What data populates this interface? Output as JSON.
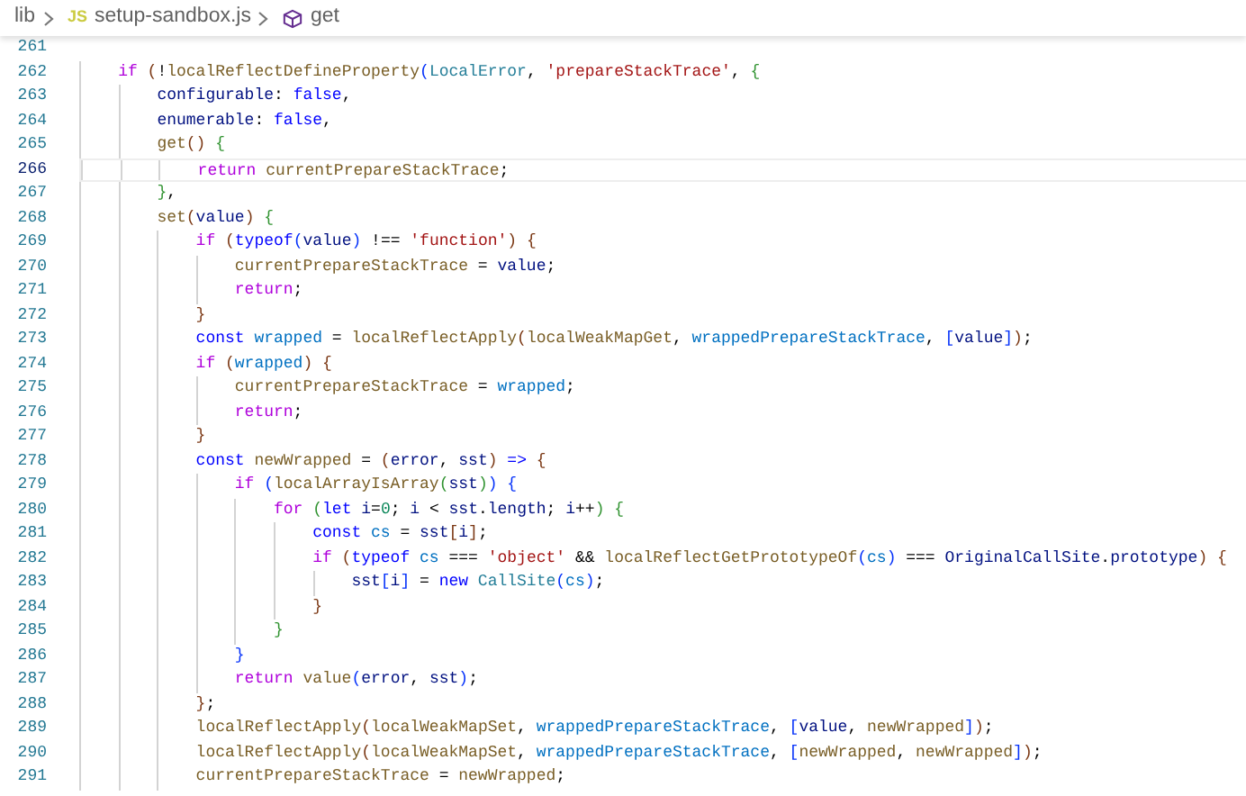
{
  "breadcrumb": {
    "folder": "lib",
    "file_icon_label": "JS",
    "file": "setup-sandbox.js",
    "symbol": "get"
  },
  "lines": [
    {
      "number": "261",
      "current": false
    },
    {
      "number": "262",
      "current": false,
      "tokens": [
        {
          "text": "    if ",
          "kind": "ctrl"
        },
        {
          "text": "(",
          "kind": "b3"
        },
        {
          "text": "!",
          "kind": "plain"
        },
        {
          "text": "localReflectDefineProperty",
          "kind": "fn"
        },
        {
          "text": "(",
          "kind": "b1"
        },
        {
          "text": "LocalError",
          "kind": "type"
        },
        {
          "text": ", ",
          "kind": "plain"
        },
        {
          "text": "'prepareStackTrace'",
          "kind": "str"
        },
        {
          "text": ", ",
          "kind": "plain"
        },
        {
          "text": "{",
          "kind": "b2"
        }
      ]
    },
    {
      "number": "263",
      "current": false,
      "tokens": [
        {
          "text": "        configurable",
          "kind": "var"
        },
        {
          "text": ": ",
          "kind": "plain"
        },
        {
          "text": "false",
          "kind": "kw"
        },
        {
          "text": ",",
          "kind": "plain"
        }
      ]
    },
    {
      "number": "264",
      "current": false,
      "tokens": [
        {
          "text": "        enumerable",
          "kind": "var"
        },
        {
          "text": ": ",
          "kind": "plain"
        },
        {
          "text": "false",
          "kind": "kw"
        },
        {
          "text": ",",
          "kind": "plain"
        }
      ]
    },
    {
      "number": "265",
      "current": false,
      "tokens": [
        {
          "text": "        get",
          "kind": "fn"
        },
        {
          "text": "() ",
          "kind": "b3"
        },
        {
          "text": "{",
          "kind": "b2"
        }
      ]
    },
    {
      "number": "266",
      "current": true,
      "tokens": [
        {
          "text": "            return ",
          "kind": "ctrl"
        },
        {
          "text": "currentPrepareStackTrace",
          "kind": "fn"
        },
        {
          "text": ";",
          "kind": "plain"
        }
      ]
    },
    {
      "number": "267",
      "current": false,
      "tokens": [
        {
          "text": "        }",
          "kind": "b2"
        },
        {
          "text": ",",
          "kind": "plain"
        }
      ]
    },
    {
      "number": "268",
      "current": false,
      "tokens": [
        {
          "text": "        set",
          "kind": "fn"
        },
        {
          "text": "(",
          "kind": "b3"
        },
        {
          "text": "value",
          "kind": "var"
        },
        {
          "text": ") ",
          "kind": "b3"
        },
        {
          "text": "{",
          "kind": "b2"
        }
      ]
    },
    {
      "number": "269",
      "current": false,
      "tokens": [
        {
          "text": "            if ",
          "kind": "ctrl"
        },
        {
          "text": "(",
          "kind": "b3"
        },
        {
          "text": "typeof",
          "kind": "kw"
        },
        {
          "text": "(",
          "kind": "b1"
        },
        {
          "text": "value",
          "kind": "var"
        },
        {
          "text": ")",
          "kind": "b1"
        },
        {
          "text": " !== ",
          "kind": "plain"
        },
        {
          "text": "'function'",
          "kind": "str"
        },
        {
          "text": ") ",
          "kind": "b3"
        },
        {
          "text": "{",
          "kind": "b3"
        }
      ]
    },
    {
      "number": "270",
      "current": false,
      "tokens": [
        {
          "text": "                currentPrepareStackTrace",
          "kind": "fn"
        },
        {
          "text": " = ",
          "kind": "plain"
        },
        {
          "text": "value",
          "kind": "var"
        },
        {
          "text": ";",
          "kind": "plain"
        }
      ]
    },
    {
      "number": "271",
      "current": false,
      "tokens": [
        {
          "text": "                return",
          "kind": "ctrl"
        },
        {
          "text": ";",
          "kind": "plain"
        }
      ]
    },
    {
      "number": "272",
      "current": false,
      "tokens": [
        {
          "text": "            }",
          "kind": "b3"
        }
      ]
    },
    {
      "number": "273",
      "current": false,
      "tokens": [
        {
          "text": "            const ",
          "kind": "kw"
        },
        {
          "text": "wrapped",
          "kind": "const"
        },
        {
          "text": " = ",
          "kind": "plain"
        },
        {
          "text": "localReflectApply",
          "kind": "fn"
        },
        {
          "text": "(",
          "kind": "b3"
        },
        {
          "text": "localWeakMapGet",
          "kind": "fn"
        },
        {
          "text": ", ",
          "kind": "plain"
        },
        {
          "text": "wrappedPrepareStackTrace",
          "kind": "const"
        },
        {
          "text": ", ",
          "kind": "plain"
        },
        {
          "text": "[",
          "kind": "b1"
        },
        {
          "text": "value",
          "kind": "var"
        },
        {
          "text": "]",
          "kind": "b1"
        },
        {
          "text": ")",
          "kind": "b3"
        },
        {
          "text": ";",
          "kind": "plain"
        }
      ]
    },
    {
      "number": "274",
      "current": false,
      "tokens": [
        {
          "text": "            if ",
          "kind": "ctrl"
        },
        {
          "text": "(",
          "kind": "b3"
        },
        {
          "text": "wrapped",
          "kind": "const"
        },
        {
          "text": ") ",
          "kind": "b3"
        },
        {
          "text": "{",
          "kind": "b3"
        }
      ]
    },
    {
      "number": "275",
      "current": false,
      "tokens": [
        {
          "text": "                currentPrepareStackTrace",
          "kind": "fn"
        },
        {
          "text": " = ",
          "kind": "plain"
        },
        {
          "text": "wrapped",
          "kind": "const"
        },
        {
          "text": ";",
          "kind": "plain"
        }
      ]
    },
    {
      "number": "276",
      "current": false,
      "tokens": [
        {
          "text": "                return",
          "kind": "ctrl"
        },
        {
          "text": ";",
          "kind": "plain"
        }
      ]
    },
    {
      "number": "277",
      "current": false,
      "tokens": [
        {
          "text": "            }",
          "kind": "b3"
        }
      ]
    },
    {
      "number": "278",
      "current": false,
      "tokens": [
        {
          "text": "            const ",
          "kind": "kw"
        },
        {
          "text": "newWrapped",
          "kind": "fn"
        },
        {
          "text": " = ",
          "kind": "plain"
        },
        {
          "text": "(",
          "kind": "b3"
        },
        {
          "text": "error",
          "kind": "var"
        },
        {
          "text": ", ",
          "kind": "plain"
        },
        {
          "text": "sst",
          "kind": "var"
        },
        {
          "text": ") ",
          "kind": "b3"
        },
        {
          "text": "=> ",
          "kind": "kw"
        },
        {
          "text": "{",
          "kind": "b3"
        }
      ]
    },
    {
      "number": "279",
      "current": false,
      "tokens": [
        {
          "text": "                if ",
          "kind": "ctrl"
        },
        {
          "text": "(",
          "kind": "b1"
        },
        {
          "text": "localArrayIsArray",
          "kind": "fn"
        },
        {
          "text": "(",
          "kind": "b2"
        },
        {
          "text": "sst",
          "kind": "var"
        },
        {
          "text": ")",
          "kind": "b2"
        },
        {
          "text": ") ",
          "kind": "b1"
        },
        {
          "text": "{",
          "kind": "b1"
        }
      ]
    },
    {
      "number": "280",
      "current": false,
      "tokens": [
        {
          "text": "                    for ",
          "kind": "ctrl"
        },
        {
          "text": "(",
          "kind": "b2"
        },
        {
          "text": "let ",
          "kind": "kw"
        },
        {
          "text": "i",
          "kind": "var"
        },
        {
          "text": "=",
          "kind": "plain"
        },
        {
          "text": "0",
          "kind": "num"
        },
        {
          "text": "; ",
          "kind": "plain"
        },
        {
          "text": "i",
          "kind": "var"
        },
        {
          "text": " < ",
          "kind": "plain"
        },
        {
          "text": "sst",
          "kind": "var"
        },
        {
          "text": ".",
          "kind": "plain"
        },
        {
          "text": "length",
          "kind": "var"
        },
        {
          "text": "; ",
          "kind": "plain"
        },
        {
          "text": "i",
          "kind": "var"
        },
        {
          "text": "++",
          "kind": "plain"
        },
        {
          "text": ") ",
          "kind": "b2"
        },
        {
          "text": "{",
          "kind": "b2"
        }
      ]
    },
    {
      "number": "281",
      "current": false,
      "tokens": [
        {
          "text": "                        const ",
          "kind": "kw"
        },
        {
          "text": "cs",
          "kind": "const"
        },
        {
          "text": " = ",
          "kind": "plain"
        },
        {
          "text": "sst",
          "kind": "var"
        },
        {
          "text": "[",
          "kind": "b3"
        },
        {
          "text": "i",
          "kind": "var"
        },
        {
          "text": "]",
          "kind": "b3"
        },
        {
          "text": ";",
          "kind": "plain"
        }
      ]
    },
    {
      "number": "282",
      "current": false,
      "tokens": [
        {
          "text": "                        if ",
          "kind": "ctrl"
        },
        {
          "text": "(",
          "kind": "b3"
        },
        {
          "text": "typeof ",
          "kind": "kw"
        },
        {
          "text": "cs",
          "kind": "const"
        },
        {
          "text": " === ",
          "kind": "plain"
        },
        {
          "text": "'object'",
          "kind": "str"
        },
        {
          "text": " && ",
          "kind": "plain"
        },
        {
          "text": "localReflectGetPrototypeOf",
          "kind": "fn"
        },
        {
          "text": "(",
          "kind": "b1"
        },
        {
          "text": "cs",
          "kind": "const"
        },
        {
          "text": ")",
          "kind": "b1"
        },
        {
          "text": " === ",
          "kind": "plain"
        },
        {
          "text": "OriginalCallSite",
          "kind": "var"
        },
        {
          "text": ".",
          "kind": "plain"
        },
        {
          "text": "prototype",
          "kind": "var"
        },
        {
          "text": ") ",
          "kind": "b3"
        },
        {
          "text": "{",
          "kind": "b3"
        }
      ]
    },
    {
      "number": "283",
      "current": false,
      "tokens": [
        {
          "text": "                            sst",
          "kind": "var"
        },
        {
          "text": "[",
          "kind": "b1"
        },
        {
          "text": "i",
          "kind": "var"
        },
        {
          "text": "]",
          "kind": "b1"
        },
        {
          "text": " = ",
          "kind": "plain"
        },
        {
          "text": "new ",
          "kind": "kw"
        },
        {
          "text": "CallSite",
          "kind": "type"
        },
        {
          "text": "(",
          "kind": "b1"
        },
        {
          "text": "cs",
          "kind": "const"
        },
        {
          "text": ")",
          "kind": "b1"
        },
        {
          "text": ";",
          "kind": "plain"
        }
      ]
    },
    {
      "number": "284",
      "current": false,
      "tokens": [
        {
          "text": "                        }",
          "kind": "b3"
        }
      ]
    },
    {
      "number": "285",
      "current": false,
      "tokens": [
        {
          "text": "                    }",
          "kind": "b2"
        }
      ]
    },
    {
      "number": "286",
      "current": false,
      "tokens": [
        {
          "text": "                }",
          "kind": "b1"
        }
      ]
    },
    {
      "number": "287",
      "current": false,
      "tokens": [
        {
          "text": "                return ",
          "kind": "ctrl"
        },
        {
          "text": "value",
          "kind": "fn"
        },
        {
          "text": "(",
          "kind": "b1"
        },
        {
          "text": "error",
          "kind": "var"
        },
        {
          "text": ", ",
          "kind": "plain"
        },
        {
          "text": "sst",
          "kind": "var"
        },
        {
          "text": ")",
          "kind": "b1"
        },
        {
          "text": ";",
          "kind": "plain"
        }
      ]
    },
    {
      "number": "288",
      "current": false,
      "tokens": [
        {
          "text": "            }",
          "kind": "b3"
        },
        {
          "text": ";",
          "kind": "plain"
        }
      ]
    },
    {
      "number": "289",
      "current": false,
      "tokens": [
        {
          "text": "            localReflectApply",
          "kind": "fn"
        },
        {
          "text": "(",
          "kind": "b3"
        },
        {
          "text": "localWeakMapSet",
          "kind": "fn"
        },
        {
          "text": ", ",
          "kind": "plain"
        },
        {
          "text": "wrappedPrepareStackTrace",
          "kind": "const"
        },
        {
          "text": ", ",
          "kind": "plain"
        },
        {
          "text": "[",
          "kind": "b1"
        },
        {
          "text": "value",
          "kind": "var"
        },
        {
          "text": ", ",
          "kind": "plain"
        },
        {
          "text": "newWrapped",
          "kind": "fn"
        },
        {
          "text": "]",
          "kind": "b1"
        },
        {
          "text": ")",
          "kind": "b3"
        },
        {
          "text": ";",
          "kind": "plain"
        }
      ]
    },
    {
      "number": "290",
      "current": false,
      "tokens": [
        {
          "text": "            localReflectApply",
          "kind": "fn"
        },
        {
          "text": "(",
          "kind": "b3"
        },
        {
          "text": "localWeakMapSet",
          "kind": "fn"
        },
        {
          "text": ", ",
          "kind": "plain"
        },
        {
          "text": "wrappedPrepareStackTrace",
          "kind": "const"
        },
        {
          "text": ", ",
          "kind": "plain"
        },
        {
          "text": "[",
          "kind": "b1"
        },
        {
          "text": "newWrapped",
          "kind": "fn"
        },
        {
          "text": ", ",
          "kind": "plain"
        },
        {
          "text": "newWrapped",
          "kind": "fn"
        },
        {
          "text": "]",
          "kind": "b1"
        },
        {
          "text": ")",
          "kind": "b3"
        },
        {
          "text": ";",
          "kind": "plain"
        }
      ]
    },
    {
      "number": "291",
      "current": false,
      "tokens": [
        {
          "text": "            currentPrepareStackTrace",
          "kind": "fn"
        },
        {
          "text": " = ",
          "kind": "plain"
        },
        {
          "text": "newWrapped",
          "kind": "fn"
        },
        {
          "text": ";",
          "kind": "plain"
        }
      ]
    }
  ]
}
